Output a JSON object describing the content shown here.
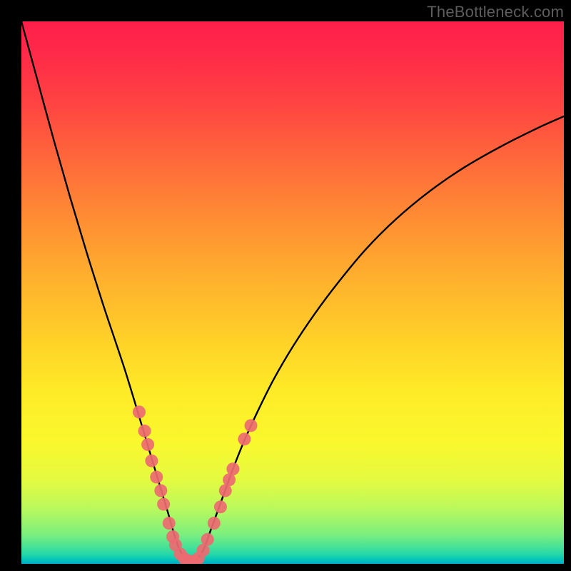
{
  "watermark": "TheBottleneck.com",
  "colors": {
    "frame": "#000000",
    "curve": "#000000",
    "dot": "#ed6a71",
    "watermark": "#5d5d5d"
  },
  "chart_data": {
    "type": "line",
    "title": "",
    "xlabel": "",
    "ylabel": "",
    "xlim": [
      0,
      100
    ],
    "ylim": [
      0,
      100
    ],
    "series": [
      {
        "name": "bottleneck-curve",
        "x": [
          0,
          3,
          6,
          9,
          12,
          15,
          17,
          19,
          21,
          22.5,
          24,
          25.5,
          27,
          28,
          29,
          30,
          31,
          32,
          33.5,
          35,
          37,
          39,
          41,
          43.5,
          46.5,
          50,
          54,
          58.5,
          63.5,
          69,
          75,
          81.5,
          88.5,
          95.5,
          100
        ],
        "y": [
          100,
          89,
          78,
          67.5,
          57.5,
          48,
          42,
          36,
          29.5,
          24.5,
          19.5,
          14.5,
          9.5,
          6,
          3,
          1.2,
          0.4,
          0.6,
          2.5,
          6.5,
          12,
          17.5,
          22.5,
          28,
          34,
          40,
          46,
          52,
          58,
          63.5,
          68.5,
          73,
          77,
          80.5,
          82.5
        ]
      }
    ],
    "scatter_points": {
      "name": "highlighted-points",
      "points": [
        {
          "x": 21.7,
          "y": 28.0
        },
        {
          "x": 22.7,
          "y": 24.5
        },
        {
          "x": 23.3,
          "y": 22.0
        },
        {
          "x": 24.0,
          "y": 19.0
        },
        {
          "x": 24.9,
          "y": 16.0
        },
        {
          "x": 25.7,
          "y": 13.5
        },
        {
          "x": 26.2,
          "y": 11.0
        },
        {
          "x": 27.2,
          "y": 7.5
        },
        {
          "x": 27.9,
          "y": 5.0
        },
        {
          "x": 28.4,
          "y": 3.5
        },
        {
          "x": 29.3,
          "y": 1.8
        },
        {
          "x": 30.1,
          "y": 0.9
        },
        {
          "x": 30.9,
          "y": 0.5
        },
        {
          "x": 31.8,
          "y": 0.5
        },
        {
          "x": 32.6,
          "y": 1.0
        },
        {
          "x": 33.5,
          "y": 2.5
        },
        {
          "x": 34.3,
          "y": 4.5
        },
        {
          "x": 35.5,
          "y": 7.5
        },
        {
          "x": 36.7,
          "y": 10.5
        },
        {
          "x": 37.6,
          "y": 13.5
        },
        {
          "x": 38.3,
          "y": 15.5
        },
        {
          "x": 39.0,
          "y": 17.5
        },
        {
          "x": 41.1,
          "y": 23.0
        },
        {
          "x": 42.3,
          "y": 25.5
        }
      ]
    },
    "gradient_stops": [
      {
        "pos": 0.0,
        "color": "#ff1f4a"
      },
      {
        "pos": 0.15,
        "color": "#ff4342"
      },
      {
        "pos": 0.37,
        "color": "#ff8f33"
      },
      {
        "pos": 0.59,
        "color": "#ffd228"
      },
      {
        "pos": 0.78,
        "color": "#faf82d"
      },
      {
        "pos": 0.9,
        "color": "#b8f95d"
      },
      {
        "pos": 0.97,
        "color": "#3fe09b"
      },
      {
        "pos": 1.0,
        "color": "#00a9c4"
      }
    ]
  }
}
